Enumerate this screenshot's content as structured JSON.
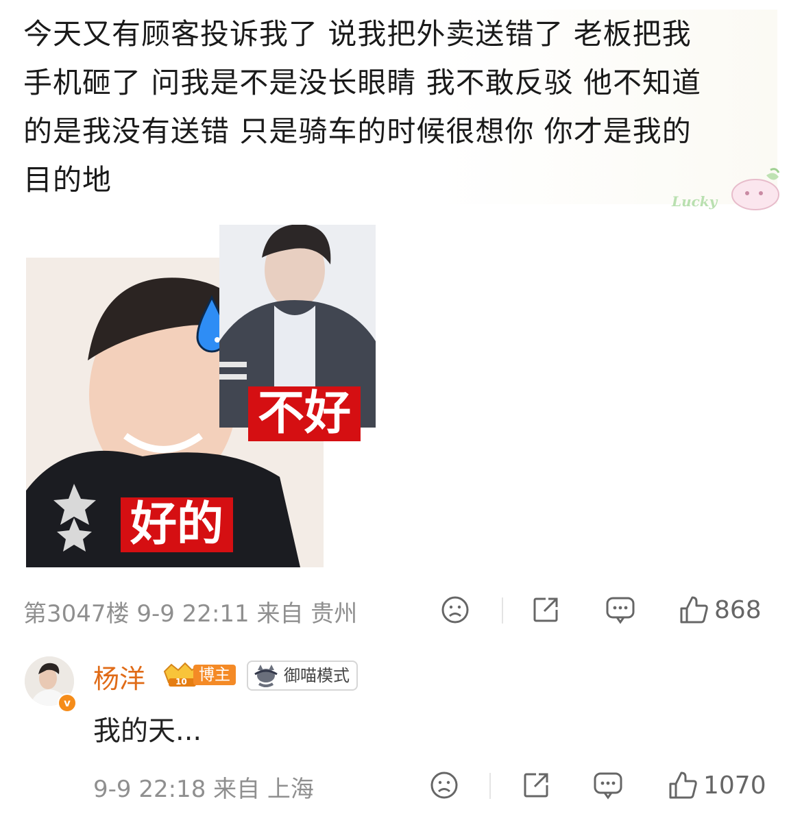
{
  "post": {
    "lines": [
      "今天又有顾客投诉我了 说我把外卖送错了 老板把我",
      "手机砸了 问我是不是没长眼睛 我不敢反驳 他不知道",
      "的是我没有送错 只是骑车的时候很想你 你才是我的",
      "目的地"
    ],
    "sticker_label": "Lucky"
  },
  "meme": {
    "caption_left": "好的",
    "caption_right": "不好"
  },
  "comment": {
    "meta": "第3047楼 9-9 22:11 来自 贵州",
    "like_count": "868"
  },
  "reply": {
    "username": "杨洋",
    "badge_level": "10",
    "badge_label": "博主",
    "mode_label": "御喵模式",
    "verified_mark": "v",
    "text": "我的天...",
    "meta": "9-9 22:18 来自 上海",
    "like_count": "1070"
  },
  "colors": {
    "username": "#e06b17",
    "caption_bg": "#d50f12",
    "badge_bg": "#f48a26",
    "meta_gray": "#8f8f8f"
  },
  "icons": [
    "sad-face-icon",
    "share-icon",
    "comment-icon",
    "thumbs-up-icon",
    "water-drop-icon",
    "cat-mode-icon"
  ]
}
